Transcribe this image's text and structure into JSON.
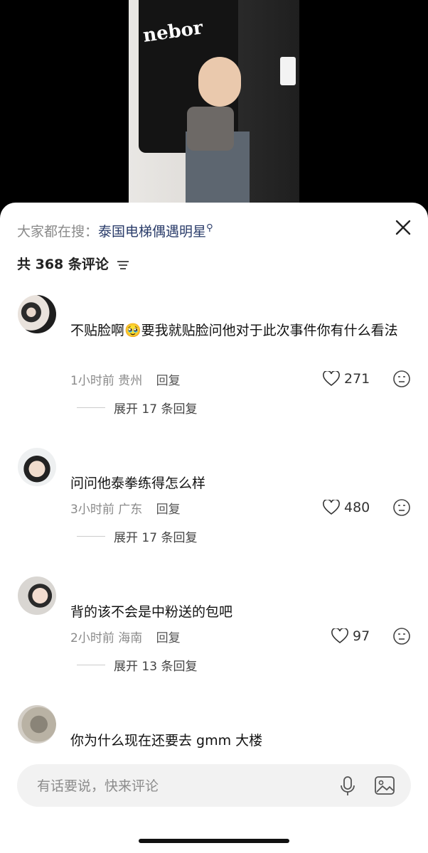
{
  "search": {
    "label": "大家都在搜：",
    "term": "泰国电梯偶遇明星"
  },
  "comment_count": "共 368 条评论",
  "video": {
    "shirt_print": "nebor"
  },
  "comments": [
    {
      "text": "不贴脸啊🥹要我就贴脸问他对于此次事件你有什么看法",
      "time": "1小时前",
      "location": "贵州",
      "reply": "回复",
      "likes": "271",
      "expand": "展开 17 条回复"
    },
    {
      "text": "问问他泰拳练得怎么样",
      "time": "3小时前",
      "location": "广东",
      "reply": "回复",
      "likes": "480",
      "expand": "展开 17 条回复"
    },
    {
      "text": "背的该不会是中粉送的包吧",
      "time": "2小时前",
      "location": "海南",
      "reply": "回复",
      "likes": "97",
      "expand": "展开 13 条回复"
    },
    {
      "text": "你为什么现在还要去 gmm 大楼"
    }
  ],
  "input": {
    "placeholder": "有话要说，快来评论"
  },
  "icons": [
    "search-mark-icon",
    "close-icon",
    "sort-icon",
    "heart-icon",
    "dislike-icon",
    "mic-icon",
    "image-icon"
  ]
}
